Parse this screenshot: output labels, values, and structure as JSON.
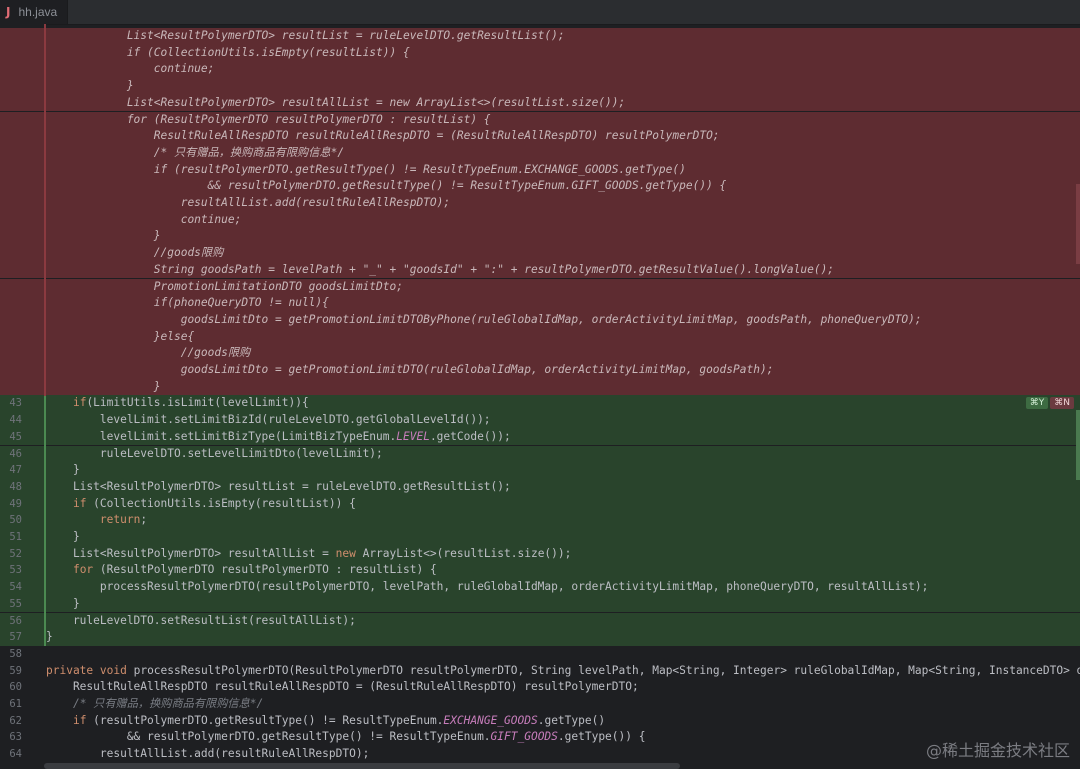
{
  "tab": {
    "label": "hh.java"
  },
  "shortcuts": {
    "accept": "⌘Y",
    "reject": "⌘N"
  },
  "watermark": "@稀土掘金技术社区",
  "removed_lines": [
    "            List<ResultPolymerDTO> resultList = ruleLevelDTO.getResultList();",
    "            if (CollectionUtils.isEmpty(resultList)) {",
    "                continue;",
    "            }",
    "            List<ResultPolymerDTO> resultAllList = new ArrayList<>(resultList.size());",
    "            for (ResultPolymerDTO resultPolymerDTO : resultList) {",
    "                ResultRuleAllRespDTO resultRuleAllRespDTO = (ResultRuleAllRespDTO) resultPolymerDTO;",
    "                /* 只有赠品，换购商品有限购信息*/",
    "                if (resultPolymerDTO.getResultType() != ResultTypeEnum.EXCHANGE_GOODS.getType()",
    "                        && resultPolymerDTO.getResultType() != ResultTypeEnum.GIFT_GOODS.getType()) {",
    "                    resultAllList.add(resultRuleAllRespDTO);",
    "                    continue;",
    "                }",
    "                //goods限购",
    "                String goodsPath = levelPath + \"_\" + \"goodsId\" + \":\" + resultPolymerDTO.getResultValue().longValue();",
    "                PromotionLimitationDTO goodsLimitDto;",
    "                if(phoneQueryDTO != null){",
    "                    goodsLimitDto = getPromotionLimitDTOByPhone(ruleGlobalIdMap, orderActivityLimitMap, goodsPath, phoneQueryDTO);",
    "                }else{",
    "                    //goods限购",
    "                    goodsLimitDto = getPromotionLimitDTO(ruleGlobalIdMap, orderActivityLimitMap, goodsPath);",
    "                }"
  ],
  "added_lines": [
    {
      "n": "43",
      "text": "    if(LimitUtils.isLimit(levelLimit)){"
    },
    {
      "n": "44",
      "text": "        levelLimit.setLimitBizId(ruleLevelDTO.getGlobalLevelId());"
    },
    {
      "n": "45",
      "text": "        levelLimit.setLimitBizType(LimitBizTypeEnum.LEVEL.getCode());"
    },
    {
      "n": "46",
      "text": "        ruleLevelDTO.setLevelLimitDto(levelLimit);"
    },
    {
      "n": "47",
      "text": "    }"
    },
    {
      "n": "48",
      "text": "    List<ResultPolymerDTO> resultList = ruleLevelDTO.getResultList();"
    },
    {
      "n": "49",
      "text": "    if (CollectionUtils.isEmpty(resultList)) {"
    },
    {
      "n": "50",
      "text": "        return;"
    },
    {
      "n": "51",
      "text": "    }"
    },
    {
      "n": "52",
      "text": "    List<ResultPolymerDTO> resultAllList = new ArrayList<>(resultList.size());"
    },
    {
      "n": "53",
      "text": "    for (ResultPolymerDTO resultPolymerDTO : resultList) {"
    },
    {
      "n": "54",
      "text": "        processResultPolymerDTO(resultPolymerDTO, levelPath, ruleGlobalIdMap, orderActivityLimitMap, phoneQueryDTO, resultAllList);"
    },
    {
      "n": "55",
      "text": "    }"
    },
    {
      "n": "56",
      "text": "    ruleLevelDTO.setResultList(resultAllList);"
    },
    {
      "n": "57",
      "text": "}"
    }
  ],
  "normal_lines": [
    {
      "n": "58",
      "text": ""
    },
    {
      "n": "59",
      "text": "private void processResultPolymerDTO(ResultPolymerDTO resultPolymerDTO, String levelPath, Map<String, Integer> ruleGlobalIdMap, Map<String, InstanceDTO> or"
    },
    {
      "n": "60",
      "text": "    ResultRuleAllRespDTO resultRuleAllRespDTO = (ResultRuleAllRespDTO) resultPolymerDTO;"
    },
    {
      "n": "61",
      "text": "    /* 只有赠品，换购商品有限购信息*/"
    },
    {
      "n": "62",
      "text": "    if (resultPolymerDTO.getResultType() != ResultTypeEnum.EXCHANGE_GOODS.getType()"
    },
    {
      "n": "63",
      "text": "            && resultPolymerDTO.getResultType() != ResultTypeEnum.GIFT_GOODS.getType()) {"
    },
    {
      "n": "64",
      "text": "        resultAllList.add(resultRuleAllRespDTO);"
    }
  ]
}
